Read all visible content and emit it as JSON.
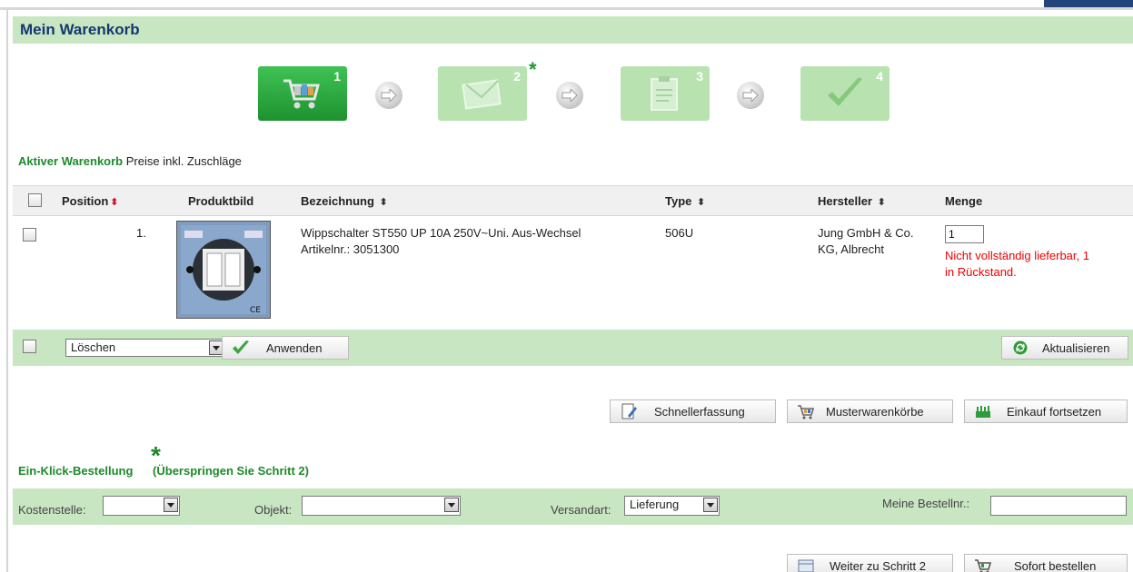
{
  "page": {
    "title": "Mein Warenkorb"
  },
  "steps": [
    {
      "number": "1",
      "icon": "shopping-cart-icon",
      "state": "active"
    },
    {
      "number": "2",
      "icon": "envelope-icon",
      "state": "inactive",
      "marker": "*"
    },
    {
      "number": "3",
      "icon": "document-icon",
      "state": "inactive"
    },
    {
      "number": "4",
      "icon": "checkmark-icon",
      "state": "inactive"
    }
  ],
  "cart_info": {
    "active_label": "Aktiver Warenkorb",
    "price_note": "Preise inkl. Zuschläge"
  },
  "table": {
    "headers": {
      "position": "Position",
      "image": "Produktbild",
      "name": "Bezeichnung",
      "type": "Type",
      "manufacturer": "Hersteller",
      "quantity": "Menge"
    },
    "sort_symbol": "⬍",
    "rows": [
      {
        "position": "1.",
        "name": "Wippschalter ST550 UP 10A 250V~Uni. Aus-Wechsel",
        "article": "Artikelnr.: 3051300",
        "type": "506U",
        "manufacturer_line1": "Jung GmbH & Co.",
        "manufacturer_line2": "KG, Albrecht",
        "quantity": "1",
        "warning_line1": "Nicht vollständig lieferbar, 1",
        "warning_line2": "in Rückstand."
      }
    ]
  },
  "bulk_actions": {
    "select_value": "Löschen",
    "apply_label": "Anwenden",
    "refresh_label": "Aktualisieren"
  },
  "extra_buttons": {
    "quick_entry": "Schnellerfassung",
    "sample_carts": "Musterwarenkörbe",
    "continue_shopping": "Einkauf fortsetzen"
  },
  "one_click": {
    "label": "Ein-Klick-Bestellung",
    "star": "*",
    "skip_note": "(Überspringen Sie Schritt 2)"
  },
  "order_fields": {
    "cost_center_label": "Kostenstelle:",
    "cost_center_value": "",
    "object_label": "Objekt:",
    "object_value": "",
    "shipping_label": "Versandart:",
    "shipping_value": "Lieferung",
    "order_number_label": "Meine Bestellnr.:",
    "order_number_value": ""
  },
  "footer_buttons": {
    "next_step": "Weiter zu Schritt 2",
    "order_now": "Sofort bestellen"
  },
  "colors": {
    "accent_green": "#1c8a2a",
    "title_blue": "#153770",
    "bar_green": "#c9e6c2",
    "warning_red": "#e00000"
  }
}
